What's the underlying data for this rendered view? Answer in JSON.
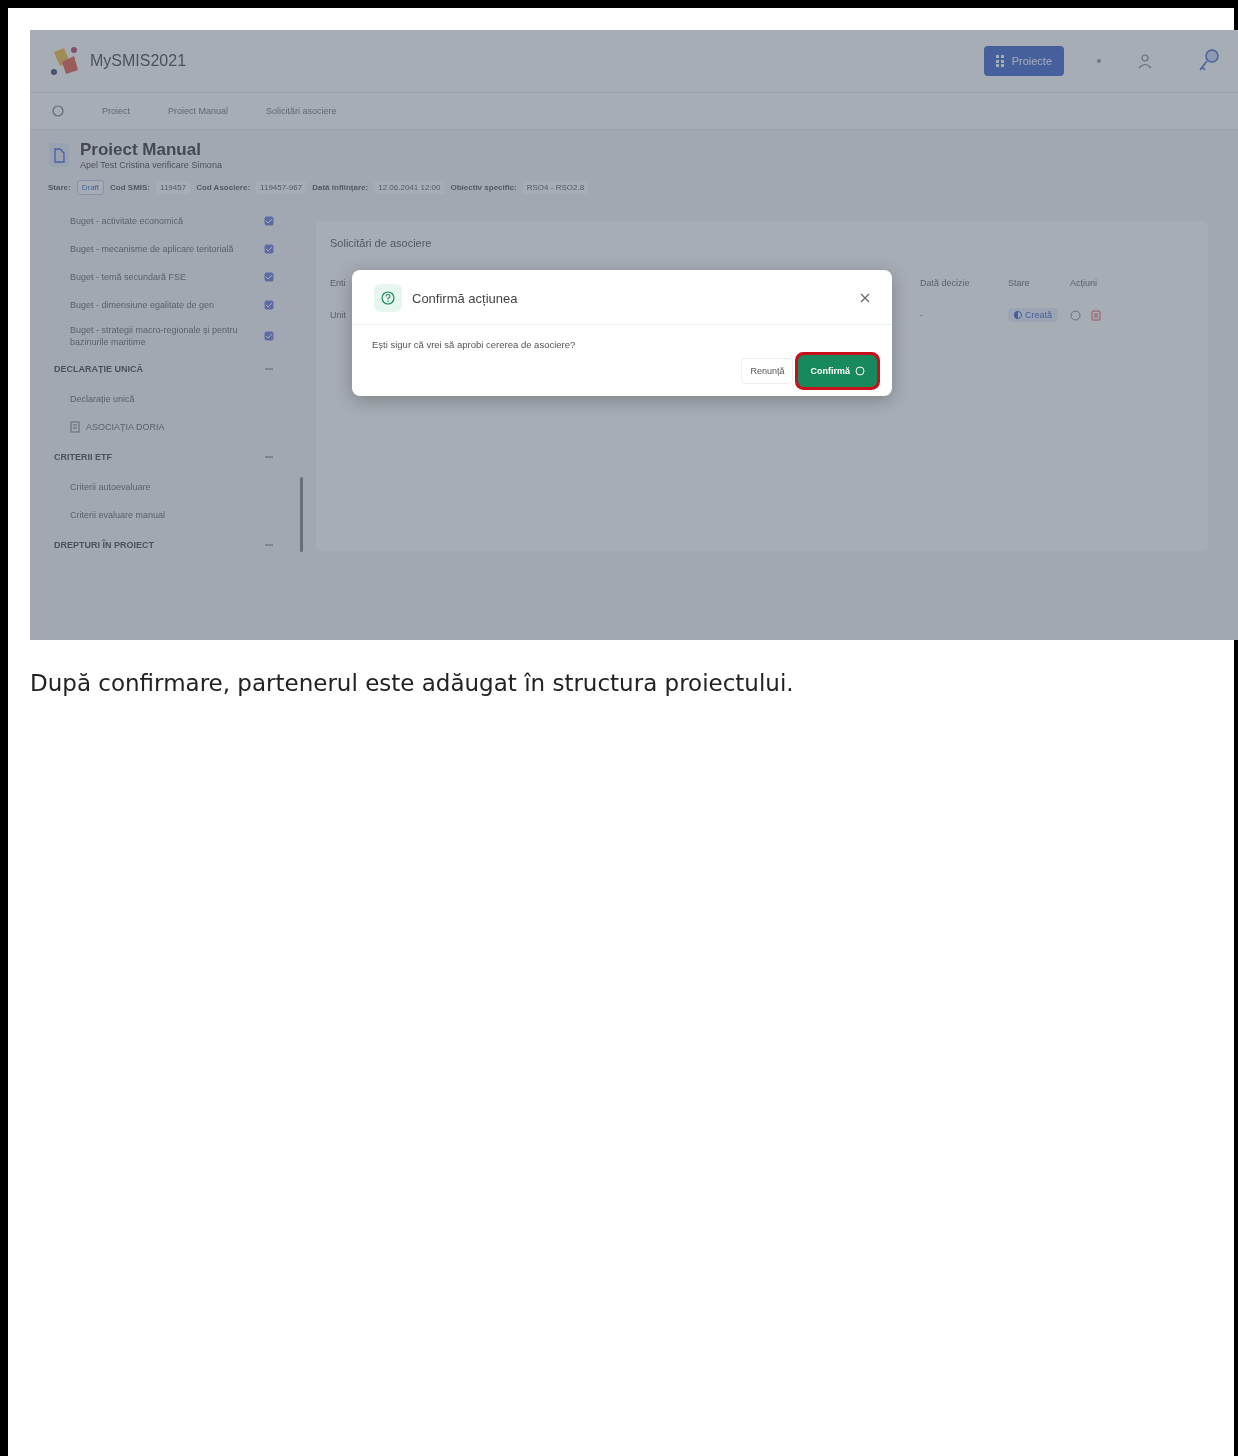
{
  "app": {
    "logo_text": "MySMIS2021",
    "projects_button": "Proiecte"
  },
  "breadcrumbs": [
    "Proiect",
    "Proiect Manual",
    "Solicitări asociere"
  ],
  "project": {
    "title": "Proiect Manual",
    "subtitle": "Apel Test Cristina verificare Simona",
    "meta": [
      {
        "label": "Stare:",
        "value": "Draft",
        "kind": "status"
      },
      {
        "label": "Cod SMIS:",
        "value": "119457",
        "kind": "plain"
      },
      {
        "label": "Cod Asociere:",
        "value": "119457-967",
        "kind": "plain"
      },
      {
        "label": "Dată înființare:",
        "value": "12.06.2041 12:00",
        "kind": "plain"
      },
      {
        "label": "Obiectiv specific:",
        "value": "RSO4 - RSO2.8",
        "kind": "plain"
      }
    ]
  },
  "sidebar": {
    "items": [
      {
        "kind": "budget",
        "label": "Buget - activitate economică"
      },
      {
        "kind": "budget",
        "label": "Buget - mecanisme de aplicare teritorială"
      },
      {
        "kind": "budget",
        "label": "Buget - temă secundară FSE"
      },
      {
        "kind": "budget",
        "label": "Buget - dimensiune egalitate de gen"
      },
      {
        "kind": "budget",
        "label": "Buget - strategii macro-regionale și pentru bazinurile maritime"
      },
      {
        "kind": "section",
        "label": "DECLARAȚIE UNICĂ",
        "expanded": true
      },
      {
        "kind": "link",
        "label": "Declarație unică"
      },
      {
        "kind": "entity",
        "label": "ASOCIAȚIA DORIA"
      },
      {
        "kind": "section",
        "label": "CRITERII ETF",
        "expanded": true
      },
      {
        "kind": "link",
        "label": "Criterii autoevaluare"
      },
      {
        "kind": "link",
        "label": "Criterii evaluare manual"
      },
      {
        "kind": "section",
        "label": "DREPTURI ÎN PROIECT",
        "expanded": true
      }
    ]
  },
  "requests": {
    "title": "Solicitări de asociere",
    "columns": [
      "Enti",
      "Dată decizie",
      "Stare",
      "Acțiuni"
    ],
    "rows": [
      {
        "column_1": "Unit",
        "decision_date": "-",
        "status": "Creată"
      }
    ]
  },
  "dialog": {
    "title": "Confirmă acțiunea",
    "message": "Ești sigur că vrei să aprobi cererea de asociere?",
    "buttons": [
      {
        "label": "Renunță",
        "kind": "cancel",
        "highlighted": false
      },
      {
        "label": "Confirmă",
        "kind": "confirm",
        "highlighted": true
      }
    ]
  },
  "caption": "După confirmare, partenerul este adăugat în structura proiectului."
}
